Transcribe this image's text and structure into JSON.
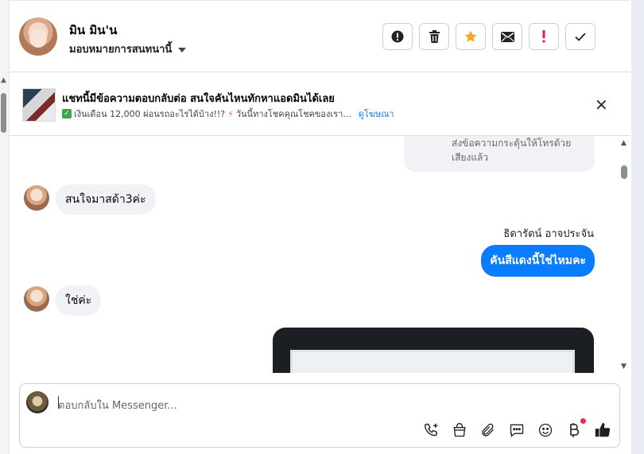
{
  "header": {
    "name": "มิน มิน'น",
    "assign_label": "มอบหมายการสนทนานี้",
    "actions": [
      "alert-icon",
      "trash-icon",
      "star-icon",
      "envelope-icon",
      "exclamation-icon",
      "check-icon"
    ],
    "colors": {
      "star": "#f5a623",
      "exclamation": "#e41e3f"
    }
  },
  "ad": {
    "title": "แชทนี้มีข้อความตอบกลับต่อ สนใจคันไหนทักหาแอดมินได้เลย",
    "subtitle_part1": "เงินเดือน 12,000 ผ่อนรถอะไรได้บ้าง!!?",
    "subtitle_part2": "วันนี้ทางโชคคุณโชคของเรา...",
    "link": "ดูโฆษณา"
  },
  "chat": {
    "voice_note_text_line1": "ส่งข้อความกระตุ้นให้โทรด้วย",
    "voice_note_text_line2": "เสียงแล้ว",
    "messages_in": [
      "สนใจมาสด้า3ค่ะ",
      "ใช่ค่ะ"
    ],
    "sender_name": "ธิดารัตน์ อาจประจัน",
    "message_out": "คันสีแดงนี้ใช่ไหมคะ"
  },
  "composer": {
    "placeholder": "ตอบกลับใน Messenger...",
    "tools": [
      "phone-plus-icon",
      "shopping-bag-icon",
      "paperclip-icon",
      "chat-bubble-icon",
      "emoji-icon",
      "baht-icon",
      "thumbs-up-icon"
    ],
    "accent": "#1877f2"
  }
}
